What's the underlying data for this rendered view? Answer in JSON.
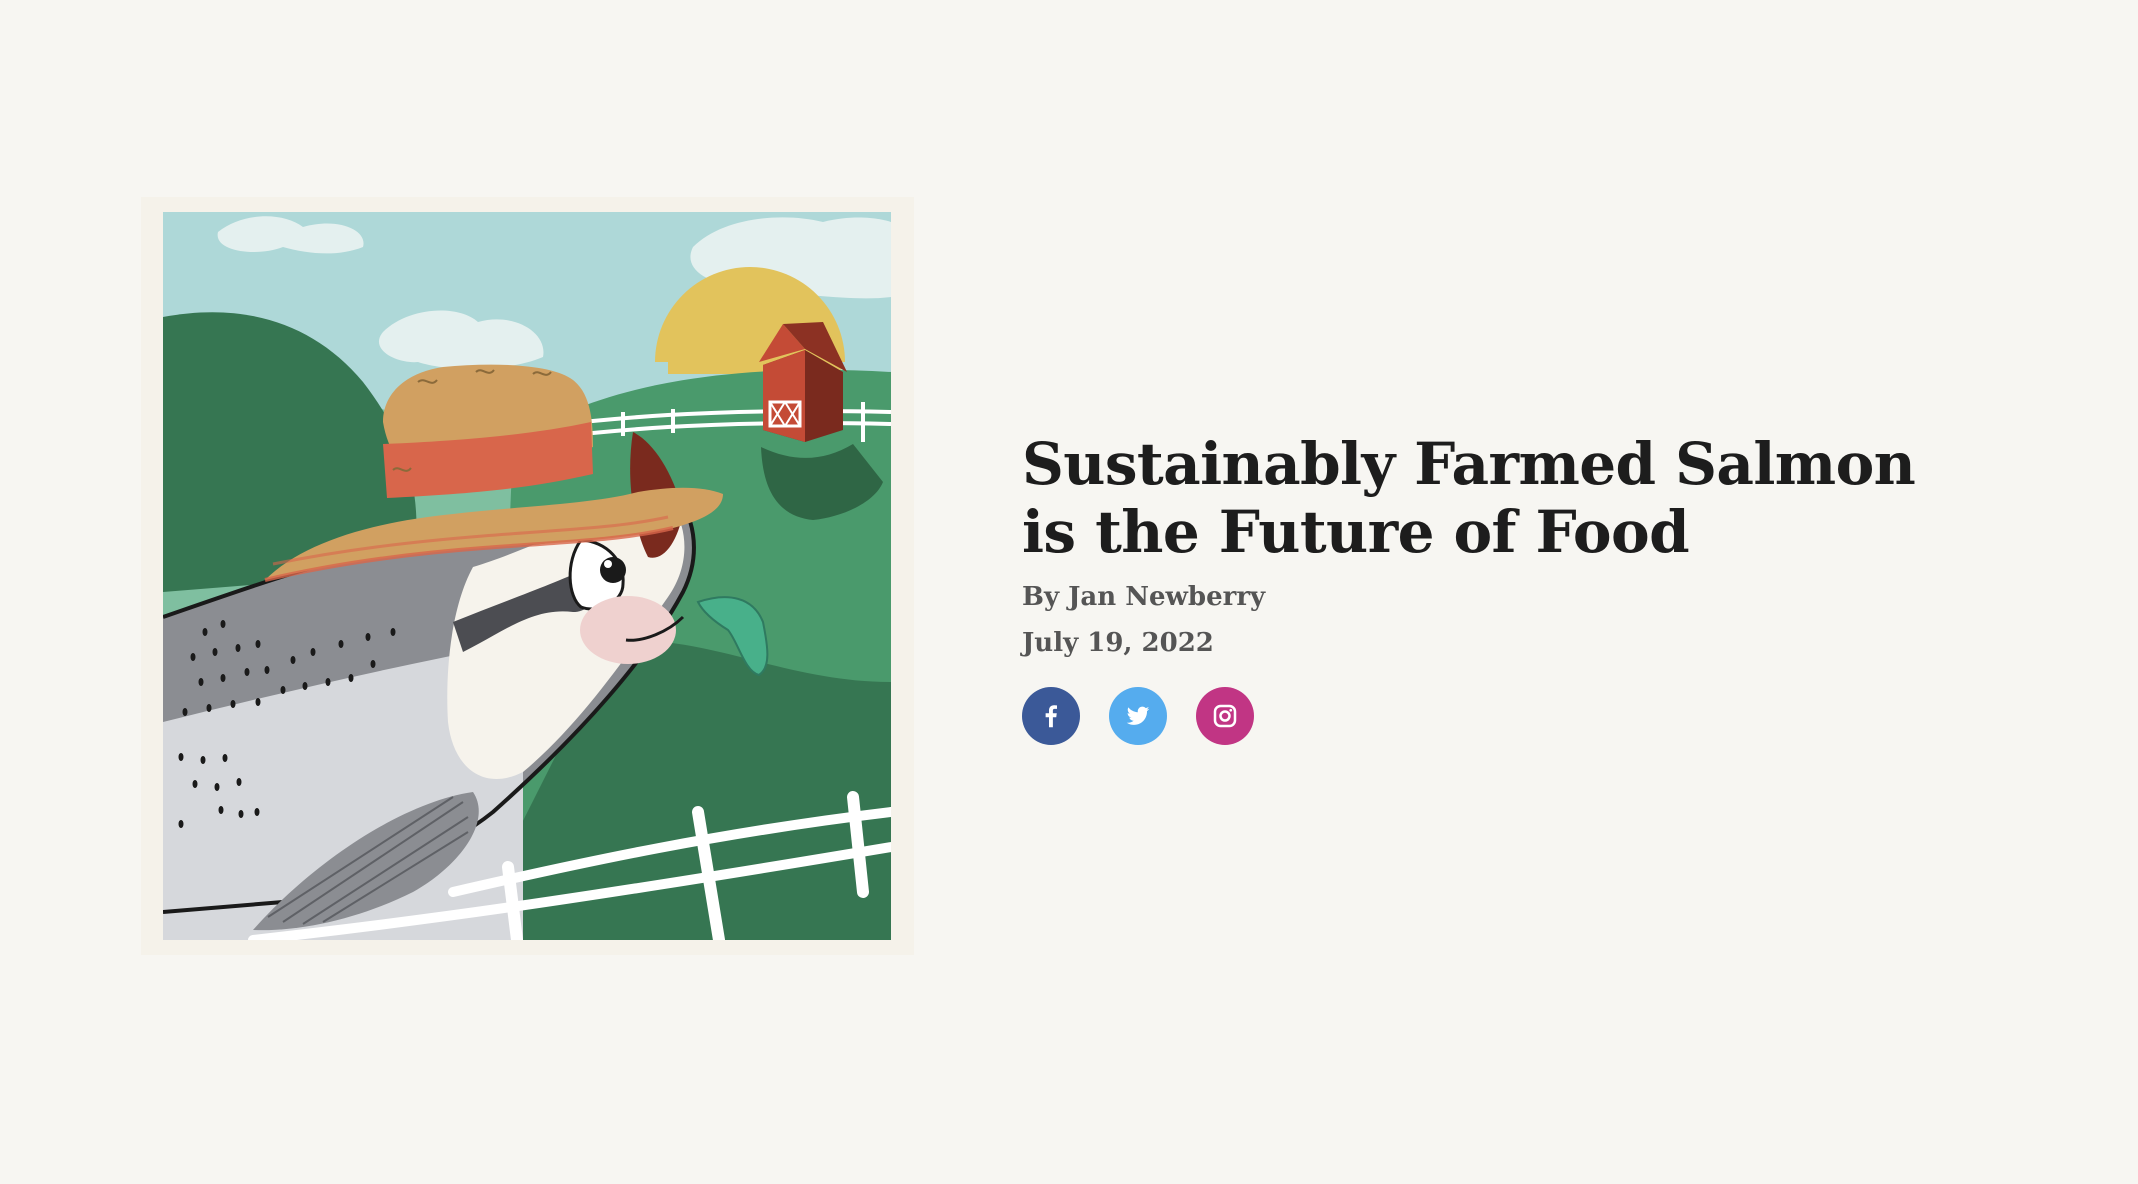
{
  "article": {
    "title": "Sustainably Farmed Salmon is the Future of Food",
    "byline": "By Jan Newberry",
    "date": "July 19, 2022"
  },
  "hero_image": {
    "alt": "Salmon wearing a straw hat on a farm"
  },
  "share": {
    "items": [
      {
        "name": "facebook",
        "icon": "facebook-icon",
        "color": "#3b5998"
      },
      {
        "name": "twitter",
        "icon": "twitter-icon",
        "color": "#55acee"
      },
      {
        "name": "instagram",
        "icon": "instagram-icon",
        "color": "#c13584"
      }
    ]
  },
  "colors": {
    "page_bg": "#f7f6f2",
    "title": "#1d1d1d",
    "meta": "#555555"
  }
}
